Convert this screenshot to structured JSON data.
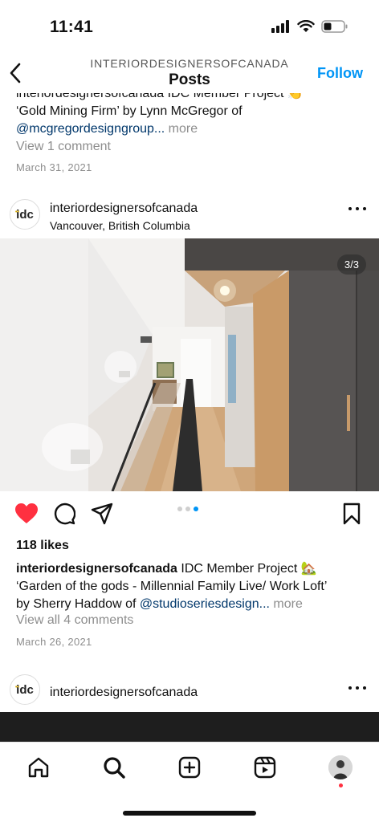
{
  "status": {
    "time": "11:41"
  },
  "nav": {
    "subtitle": "INTERIORDESIGNERSOFCANADA",
    "title": "Posts",
    "follow_label": "Follow"
  },
  "prev_post": {
    "caption_line1": "interiordesignersofcanada IDC Member Project 👏",
    "caption_line2": "‘Gold Mining Firm’ by Lynn McGregor of",
    "mention": "@mcgregordesigngroup...",
    "more": " more",
    "comments": "View 1 comment",
    "date": "March 31, 2021"
  },
  "post": {
    "avatar_text": "idc",
    "username": "interiordesignersofcanada",
    "location": "Vancouver, British Columbia",
    "image_counter": "3/3",
    "carousel": {
      "count": 3,
      "active_index": 2
    },
    "likes": "118 likes",
    "caption_user": "interiordesignersofcanada",
    "caption_text1": " IDC Member Project 🏡",
    "caption_text2": "‘Garden of the gods - Millennial Family Live/ Work Loft’",
    "caption_text3": "by Sherry Haddow of ",
    "caption_mention": "@studioseriesdesign...",
    "caption_more": " more",
    "comments": "View all 4 comments",
    "date": "March 26, 2021"
  },
  "next_post": {
    "avatar_text": "idc",
    "username": "interiordesignersofcanada"
  },
  "colors": {
    "accent": "#0095f6",
    "like": "#ff3040",
    "link": "#00376b",
    "muted": "#8e8e8e"
  },
  "icons": [
    "back-arrow-icon",
    "more-icon",
    "heart-icon",
    "comment-icon",
    "share-icon",
    "bookmark-icon",
    "home-icon",
    "search-icon",
    "create-icon",
    "reels-icon",
    "profile-avatar"
  ]
}
